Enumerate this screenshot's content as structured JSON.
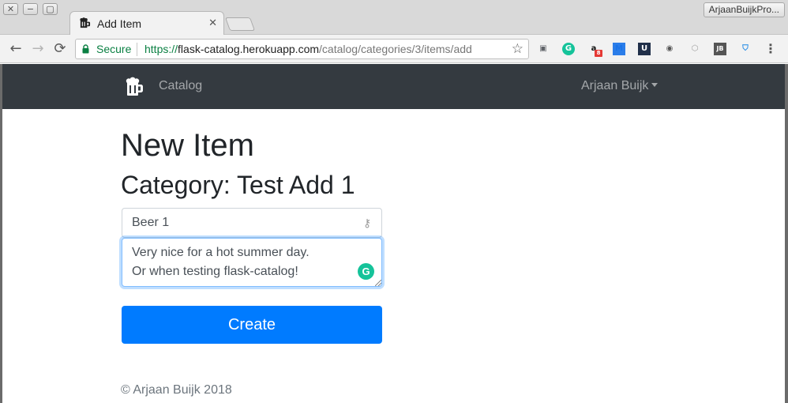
{
  "window": {
    "close_glyph": "✕",
    "minimize_glyph": "−",
    "maximize_glyph": "▢",
    "profile_name": "ArjaanBuijkPro..."
  },
  "tab": {
    "favicon": "beer-mug-icon",
    "title": "Add Item",
    "close_glyph": "✕"
  },
  "toolbar": {
    "back_glyph": "←",
    "forward_glyph": "→",
    "reload_glyph": "⟳",
    "secure_label": "Secure",
    "url_scheme": "https://",
    "url_host": "flask-catalog.herokuapp.com",
    "url_path": "/catalog/categories/3/items/add",
    "star_glyph": "☆",
    "extensions": [
      {
        "name": "pocket-icon",
        "glyph": "▣",
        "color": "#5f6368"
      },
      {
        "name": "grammarly-icon",
        "glyph": "G",
        "color": "#15c39a"
      },
      {
        "name": "amazon-icon",
        "glyph": "a",
        "color": "#111111",
        "badge": "8"
      },
      {
        "name": "m-icon",
        "glyph": "M",
        "color": "#1a73e8"
      },
      {
        "name": "dark-u-icon",
        "glyph": "U",
        "color": "#ffffff"
      },
      {
        "name": "eye-icon",
        "glyph": "◉",
        "color": "#555555"
      },
      {
        "name": "cube-icon",
        "glyph": "⬡",
        "color": "#9e9e9e"
      },
      {
        "name": "jb-icon",
        "glyph": "JB",
        "color": "#ffffff"
      },
      {
        "name": "shield-icon",
        "glyph": "⛉",
        "color": "#1e88e5"
      },
      {
        "name": "menu-icon",
        "glyph": "⋮",
        "color": "#555555"
      }
    ]
  },
  "navbar": {
    "brand_icon": "beer-mug-icon",
    "brand": "Catalog",
    "user": "Arjaan Buijk"
  },
  "main": {
    "heading": "New Item",
    "subheading": "Category: Test Add 1",
    "name_value": "Beer 1",
    "description_value": "Very nice for a hot summer day.\nOr when testing flask-catalog!",
    "grammarly_glyph": "G",
    "submit_label": "Create",
    "footer": "© Arjaan Buijk 2018"
  },
  "colors": {
    "navbar_bg": "#343a40",
    "primary": "#007bff",
    "secure_green": "#0b8043",
    "grammarly_green": "#15c39a"
  }
}
